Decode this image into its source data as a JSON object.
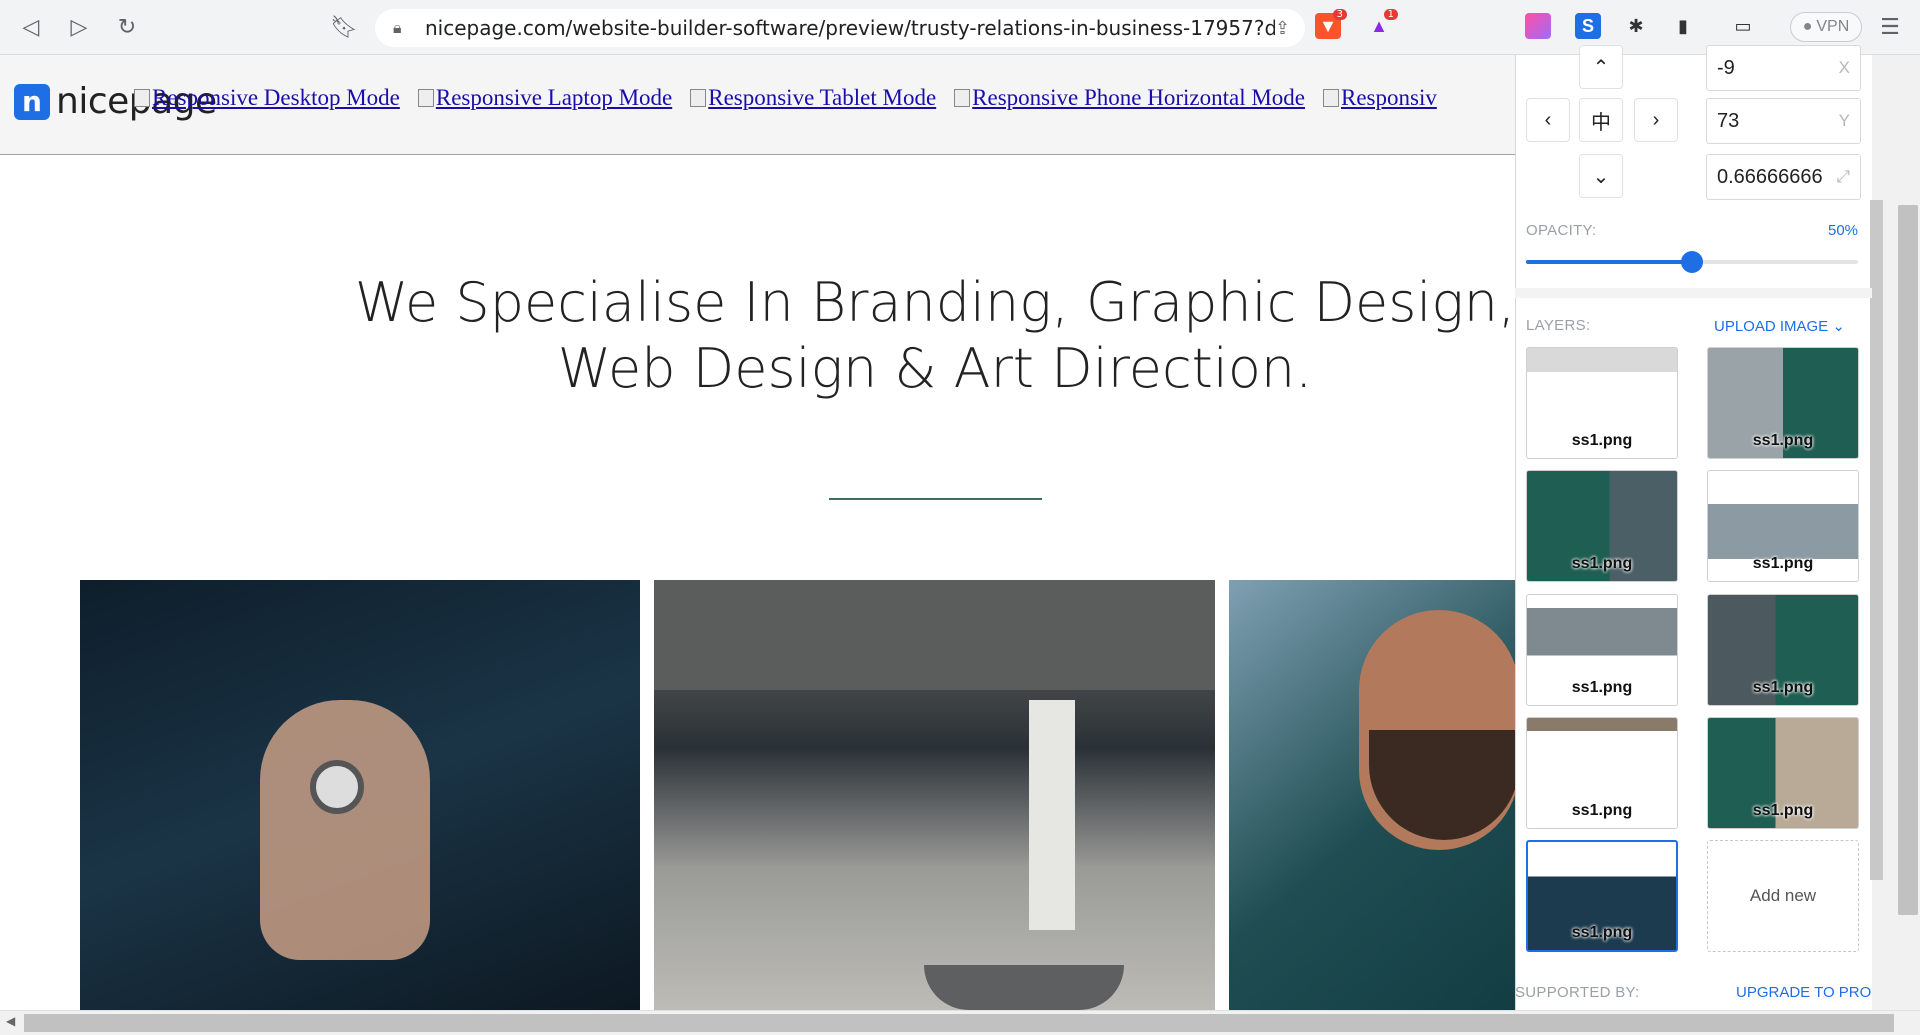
{
  "browser": {
    "url": "nicepage.com/website-builder-software/preview/trusty-relations-in-business-17957?d...",
    "vpn_label": "VPN",
    "brave_badge": "3",
    "alert_badge": "1"
  },
  "site": {
    "logo_text": "nicepage",
    "modes": [
      "Responsive Desktop Mode",
      "Responsive Laptop Mode",
      "Responsive Tablet Mode",
      "Responsive Phone Horizontal Mode",
      "Responsiv"
    ],
    "headline_line1": "We Specialise In Branding, Graphic Design,",
    "headline_line2": "Web Design & Art Direction."
  },
  "panel": {
    "x_value": "-9",
    "x_axis": "X",
    "y_value": "73",
    "y_axis": "Y",
    "scale_value": "0.66666666",
    "opacity_label": "OPACITY:",
    "opacity_value": "50%",
    "opacity_fraction": 0.5,
    "layers_label": "LAYERS:",
    "upload_label": "UPLOAD IMAGE",
    "layer_caption": "ss1.png",
    "add_new_label": "Add new",
    "supported_label": "SUPPORTED BY:",
    "upgrade_label": "UPGRADE TO PRO"
  },
  "colors": {
    "accent": "#1e6fe5",
    "brand_green": "#1f5e52"
  }
}
